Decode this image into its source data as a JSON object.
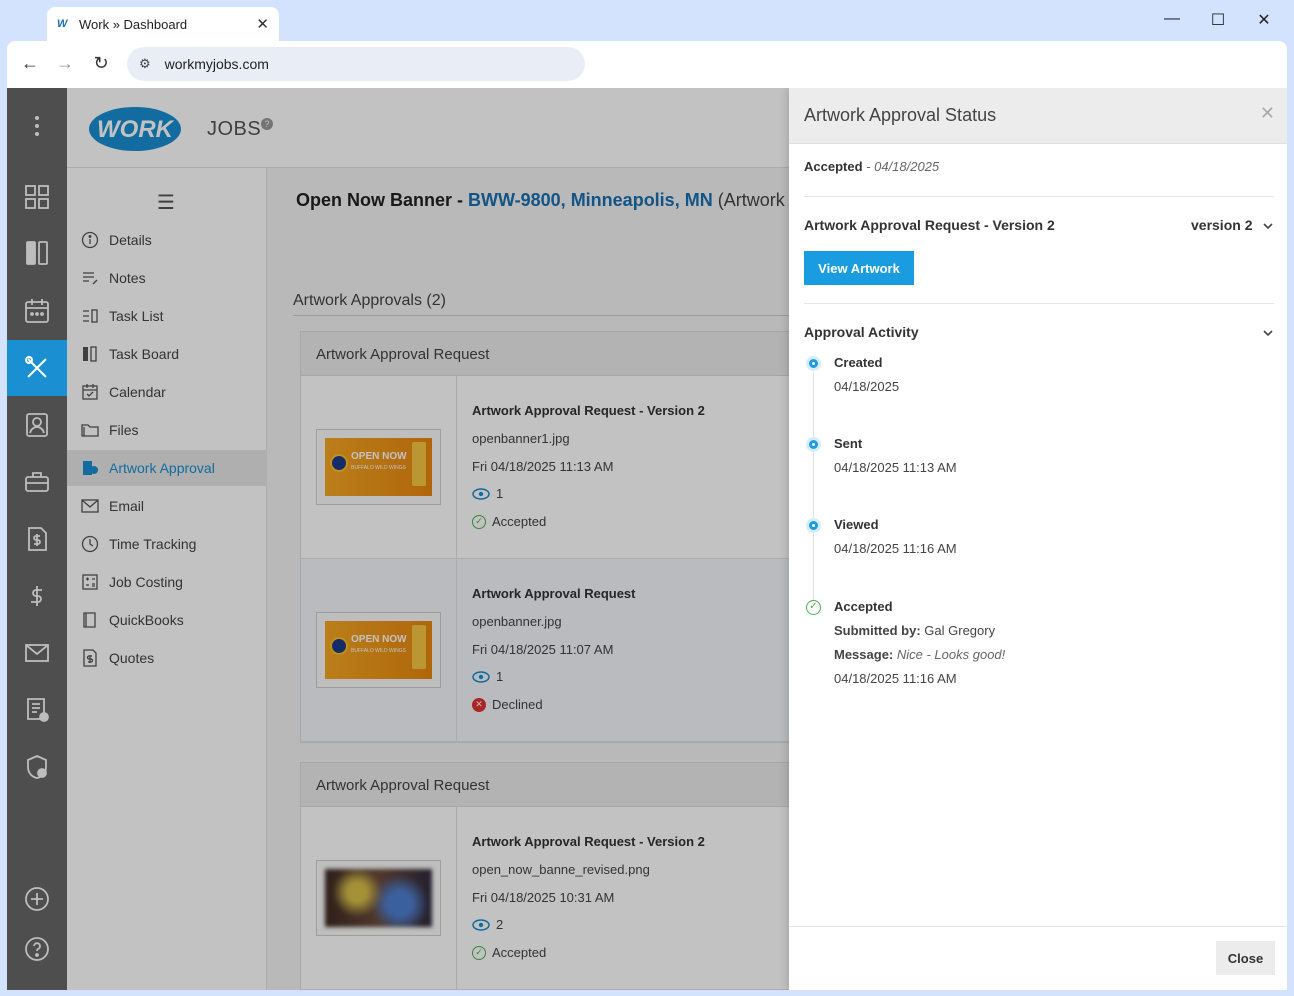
{
  "browser": {
    "tab_title": "Work » Dashboard",
    "url": "workmyjobs.com"
  },
  "header": {
    "logo_text": "WORK",
    "module": "JOBS"
  },
  "sidenav": {
    "items": [
      {
        "label": "Details",
        "icon": "info-icon"
      },
      {
        "label": "Notes",
        "icon": "notes-icon"
      },
      {
        "label": "Task List",
        "icon": "task-list-icon"
      },
      {
        "label": "Task Board",
        "icon": "task-board-icon"
      },
      {
        "label": "Calendar",
        "icon": "calendar-icon"
      },
      {
        "label": "Files",
        "icon": "folder-icon"
      },
      {
        "label": "Artwork Approval",
        "icon": "artwork-approval-icon",
        "active": true
      },
      {
        "label": "Email",
        "icon": "email-icon"
      },
      {
        "label": "Time Tracking",
        "icon": "clock-icon"
      },
      {
        "label": "Job Costing",
        "icon": "calculator-icon"
      },
      {
        "label": "QuickBooks",
        "icon": "book-icon"
      },
      {
        "label": "Quotes",
        "icon": "quote-icon"
      }
    ]
  },
  "job": {
    "title_prefix": "Open Now Banner -",
    "title_link": "BWW-9800, Minneapolis, MN",
    "title_rest": "(Artwork Ap"
  },
  "approvals": {
    "section_title": "Artwork Approvals (2)",
    "cards": [
      {
        "header": "Artwork Approval Request",
        "rows": [
          {
            "title": "Artwork Approval Request - Version 2",
            "file": "openbanner1.jpg",
            "date": "Fri 04/18/2025 11:13 AM",
            "views": "1",
            "status": "Accepted"
          },
          {
            "title": "Artwork Approval Request",
            "file": "openbanner.jpg",
            "date": "Fri 04/18/2025 11:07 AM",
            "views": "1",
            "status": "Declined"
          }
        ]
      },
      {
        "header": "Artwork Approval Request",
        "rows": [
          {
            "title": "Artwork Approval Request - Version 2",
            "file": "open_now_banne_revised.png",
            "date": "Fri 04/18/2025 10:31 AM",
            "views": "2",
            "status": "Accepted"
          }
        ]
      }
    ],
    "banner_text": "OPEN NOW",
    "banner_sub": "BUFFALO WILD WINGS"
  },
  "drawer": {
    "title": "Artwork Approval Status",
    "status_label": "Accepted",
    "status_date": "- 04/18/2025",
    "request_title": "Artwork Approval Request - Version 2",
    "version_label": "version 2",
    "view_button": "View Artwork",
    "activity_title": "Approval Activity",
    "timeline": [
      {
        "event": "Created",
        "time": "04/18/2025"
      },
      {
        "event": "Sent",
        "time": "04/18/2025 11:13 AM"
      },
      {
        "event": "Viewed",
        "time": "04/18/2025 11:16 AM"
      },
      {
        "event": "Accepted",
        "time": "04/18/2025 11:16 AM"
      }
    ],
    "submitted_label": "Submitted by:",
    "submitted_by": "Gal Gregory",
    "message_label": "Message:",
    "message": "Nice - Looks good!",
    "close_button": "Close"
  },
  "colors": {
    "accent": "#1a9ce0",
    "link": "#1a6fb0",
    "success": "#4caf50",
    "danger": "#e03131",
    "rail": "#4e4e4e"
  }
}
